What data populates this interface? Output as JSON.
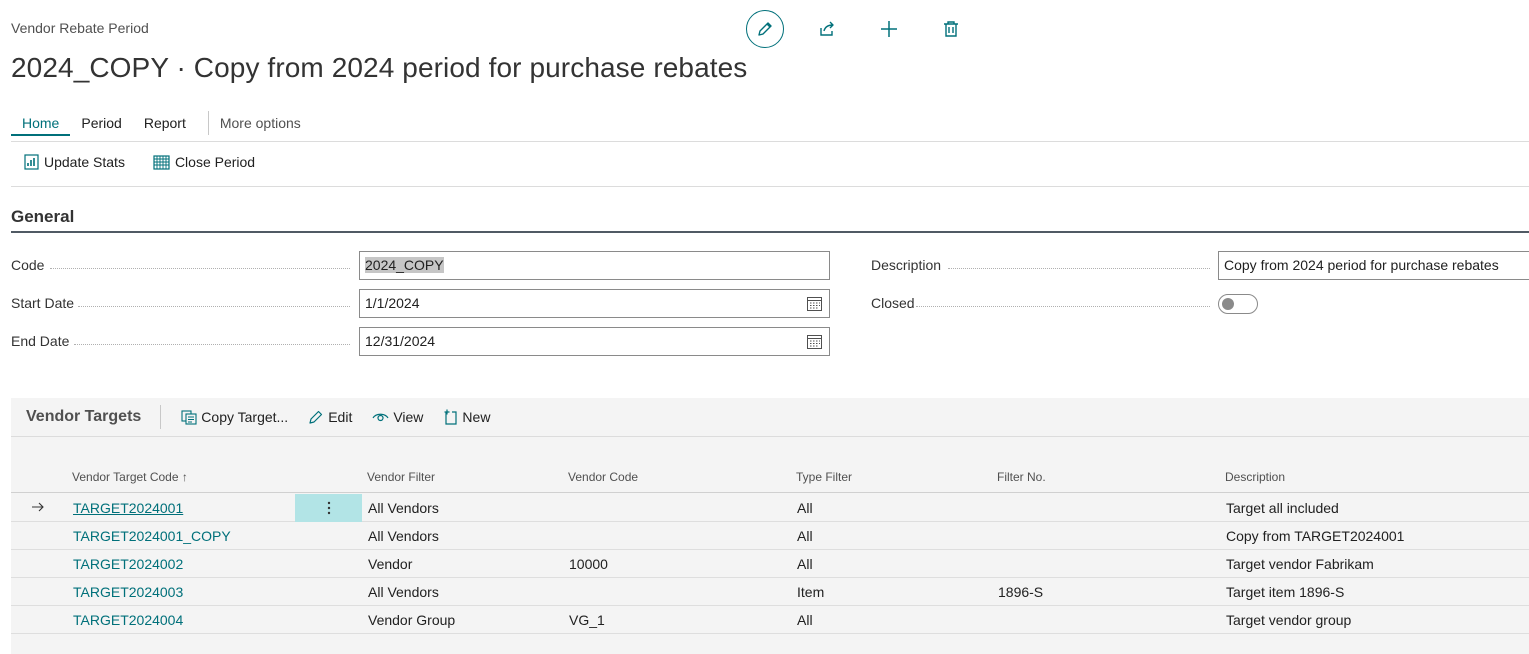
{
  "header": {
    "breadcrumb": "Vendor Rebate Period",
    "title": "2024_COPY · Copy from 2024 period for purchase rebates"
  },
  "top_actions": [
    "edit-icon",
    "share-icon",
    "add-icon",
    "delete-icon"
  ],
  "menu": {
    "items": [
      {
        "label": "Home",
        "active": true
      },
      {
        "label": "Period"
      },
      {
        "label": "Report"
      }
    ],
    "more_label": "More options"
  },
  "actions": {
    "update_stats": "Update Stats",
    "close_period": "Close Period"
  },
  "general": {
    "title": "General",
    "code_label": "Code",
    "code_value": "2024_COPY",
    "start_date_label": "Start Date",
    "start_date_value": "1/1/2024",
    "end_date_label": "End Date",
    "end_date_value": "12/31/2024",
    "description_label": "Description",
    "description_value": "Copy from 2024 period for purchase rebates",
    "closed_label": "Closed",
    "closed_value": false
  },
  "vendor_targets": {
    "title": "Vendor Targets",
    "actions": {
      "copy_target": "Copy Target...",
      "edit": "Edit",
      "view": "View",
      "new": "New"
    },
    "columns": {
      "code": "Vendor Target Code ↑",
      "vendor_filter": "Vendor Filter",
      "vendor_code": "Vendor Code",
      "type_filter": "Type Filter",
      "filter_no": "Filter No.",
      "description": "Description"
    },
    "rows": [
      {
        "code": "TARGET2024001",
        "vendor_filter": "All Vendors",
        "vendor_code": "",
        "type_filter": "All",
        "filter_no": "",
        "description": "Target all included"
      },
      {
        "code": "TARGET2024001_COPY",
        "vendor_filter": "All Vendors",
        "vendor_code": "",
        "type_filter": "All",
        "filter_no": "",
        "description": "Copy from TARGET2024001"
      },
      {
        "code": "TARGET2024002",
        "vendor_filter": "Vendor",
        "vendor_code": "10000",
        "type_filter": "All",
        "filter_no": "",
        "description": "Target vendor Fabrikam"
      },
      {
        "code": "TARGET2024003",
        "vendor_filter": "All Vendors",
        "vendor_code": "",
        "type_filter": "Item",
        "filter_no": "1896-S",
        "description": "Target item 1896-S"
      },
      {
        "code": "TARGET2024004",
        "vendor_filter": "Vendor Group",
        "vendor_code": "VG_1",
        "type_filter": "All",
        "filter_no": "",
        "description": "Target vendor group"
      }
    ]
  },
  "colors": {
    "accent": "#00707a",
    "row_selected": "#b2e4e6"
  }
}
